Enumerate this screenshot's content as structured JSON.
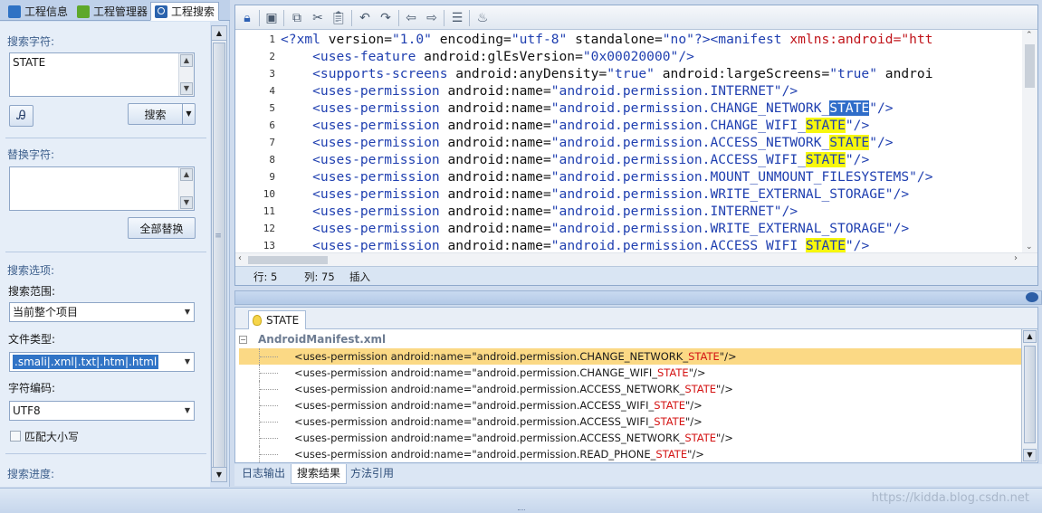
{
  "left_tabs": [
    {
      "label": "工程信息",
      "icon": "project-info-icon"
    },
    {
      "label": "工程管理器",
      "icon": "android-icon"
    },
    {
      "label": "工程搜索",
      "icon": "search-icon"
    }
  ],
  "search": {
    "group_title": "搜索字符:",
    "value": "STATE",
    "button_label": "搜索"
  },
  "replace": {
    "group_title": "替换字符:",
    "value": "",
    "button_label": "全部替换"
  },
  "options": {
    "group_title": "搜索选项:",
    "scope_label": "搜索范围:",
    "scope_value": "当前整个项目",
    "filetype_label": "文件类型:",
    "filetype_value": ".smali|.xml|.txt|.htm|.html",
    "encoding_label": "字符编码:",
    "encoding_value": "UTF8",
    "match_case_label": "匹配大小写",
    "match_case_checked": false
  },
  "progress": {
    "group_title": "搜索进度:"
  },
  "editor": {
    "toolbar_icons": [
      "lock-icon",
      "save-icon",
      "copy-icon",
      "cut-icon",
      "paste-icon",
      "undo-icon",
      "redo-icon",
      "back-icon",
      "forward-icon",
      "format-icon",
      "java-icon"
    ],
    "lines": [
      {
        "n": "1",
        "segments": [
          [
            "tag",
            "<?xml "
          ],
          [
            "attr",
            "version="
          ],
          [
            "str",
            "\"1.0\" "
          ],
          [
            "attr",
            "encoding="
          ],
          [
            "str",
            "\"utf-8\" "
          ],
          [
            "attr",
            "standalone="
          ],
          [
            "str",
            "\"no\""
          ],
          [
            "tag",
            "?><manifest "
          ],
          [
            "attr-red",
            "xmlns:android="
          ],
          [
            "attr-red",
            "\"htt"
          ]
        ]
      },
      {
        "n": "2",
        "segments": [
          [
            "tag",
            "    <uses-feature "
          ],
          [
            "attr",
            "android:glEsVersion="
          ],
          [
            "str",
            "\"0x00020000\""
          ],
          [
            "tag",
            "/>"
          ]
        ]
      },
      {
        "n": "3",
        "segments": [
          [
            "tag",
            "    <supports-screens "
          ],
          [
            "attr",
            "android:anyDensity="
          ],
          [
            "str",
            "\"true\" "
          ],
          [
            "attr",
            "android:largeScreens="
          ],
          [
            "str",
            "\"true\" "
          ],
          [
            "attr",
            "androi"
          ]
        ]
      },
      {
        "n": "4",
        "segments": [
          [
            "tag",
            "    <uses-permission "
          ],
          [
            "attr",
            "android:name="
          ],
          [
            "str",
            "\"android.permission.INTERNET\""
          ],
          [
            "tag",
            "/>"
          ]
        ]
      },
      {
        "n": "5",
        "segments": [
          [
            "tag",
            "    <uses-permission "
          ],
          [
            "attr",
            "android:name="
          ],
          [
            "str",
            "\"android.permission.CHANGE_NETWORK_"
          ],
          [
            "hl-sel",
            "STATE"
          ],
          [
            "str",
            "\""
          ],
          [
            "tag",
            "/>"
          ]
        ]
      },
      {
        "n": "6",
        "segments": [
          [
            "tag",
            "    <uses-permission "
          ],
          [
            "attr",
            "android:name="
          ],
          [
            "str",
            "\"android.permission.CHANGE_WIFI_"
          ],
          [
            "hl-yellow",
            "STATE"
          ],
          [
            "str",
            "\""
          ],
          [
            "tag",
            "/>"
          ]
        ]
      },
      {
        "n": "7",
        "segments": [
          [
            "tag",
            "    <uses-permission "
          ],
          [
            "attr",
            "android:name="
          ],
          [
            "str",
            "\"android.permission.ACCESS_NETWORK_"
          ],
          [
            "hl-yellow",
            "STATE"
          ],
          [
            "str",
            "\""
          ],
          [
            "tag",
            "/>"
          ]
        ]
      },
      {
        "n": "8",
        "segments": [
          [
            "tag",
            "    <uses-permission "
          ],
          [
            "attr",
            "android:name="
          ],
          [
            "str",
            "\"android.permission.ACCESS_WIFI_"
          ],
          [
            "hl-yellow",
            "STATE"
          ],
          [
            "str",
            "\""
          ],
          [
            "tag",
            "/>"
          ]
        ]
      },
      {
        "n": "9",
        "segments": [
          [
            "tag",
            "    <uses-permission "
          ],
          [
            "attr",
            "android:name="
          ],
          [
            "str",
            "\"android.permission.MOUNT_UNMOUNT_FILESYSTEMS\""
          ],
          [
            "tag",
            "/>"
          ]
        ]
      },
      {
        "n": "10",
        "segments": [
          [
            "tag",
            "    <uses-permission "
          ],
          [
            "attr",
            "android:name="
          ],
          [
            "str",
            "\"android.permission.WRITE_EXTERNAL_STORAGE\""
          ],
          [
            "tag",
            "/>"
          ]
        ]
      },
      {
        "n": "11",
        "segments": [
          [
            "tag",
            "    <uses-permission "
          ],
          [
            "attr",
            "android:name="
          ],
          [
            "str",
            "\"android.permission.INTERNET\""
          ],
          [
            "tag",
            "/>"
          ]
        ]
      },
      {
        "n": "12",
        "segments": [
          [
            "tag",
            "    <uses-permission "
          ],
          [
            "attr",
            "android:name="
          ],
          [
            "str",
            "\"android.permission.WRITE_EXTERNAL_STORAGE\""
          ],
          [
            "tag",
            "/>"
          ]
        ]
      },
      {
        "n": "13",
        "segments": [
          [
            "tag",
            "    <uses-permission "
          ],
          [
            "attr",
            "android:name="
          ],
          [
            "str",
            "\"android.permission.ACCESS_WIFI_"
          ],
          [
            "hl-yellow",
            "STATE"
          ],
          [
            "str",
            "\""
          ],
          [
            "tag",
            "/>"
          ]
        ]
      }
    ],
    "status": {
      "row_label": "行: 5",
      "col_label": "列: 75",
      "mode_label": "插入"
    }
  },
  "results": {
    "tab_label": "STATE",
    "file_name": "AndroidManifest.xml",
    "rows": [
      {
        "prefix": "<uses-permission android:name=\"android.permission.CHANGE_NETWORK_",
        "match": "STATE",
        "suffix": "\"/>",
        "selected": true
      },
      {
        "prefix": "<uses-permission android:name=\"android.permission.CHANGE_WIFI_",
        "match": "STATE",
        "suffix": "\"/>",
        "selected": false
      },
      {
        "prefix": "<uses-permission android:name=\"android.permission.ACCESS_NETWORK_",
        "match": "STATE",
        "suffix": "\"/>",
        "selected": false
      },
      {
        "prefix": "<uses-permission android:name=\"android.permission.ACCESS_WIFI_",
        "match": "STATE",
        "suffix": "\"/>",
        "selected": false
      },
      {
        "prefix": "<uses-permission android:name=\"android.permission.ACCESS_WIFI_",
        "match": "STATE",
        "suffix": "\"/>",
        "selected": false
      },
      {
        "prefix": "<uses-permission android:name=\"android.permission.ACCESS_NETWORK_",
        "match": "STATE",
        "suffix": "\"/>",
        "selected": false
      },
      {
        "prefix": "<uses-permission android:name=\"android.permission.READ_PHONE_",
        "match": "STATE",
        "suffix": "\"/>",
        "selected": false
      }
    ]
  },
  "bottom_tabs": [
    "日志输出",
    "搜索结果",
    "方法引用"
  ],
  "bottom_tab_active": 1,
  "watermark": "https://kidda.blog.csdn.net",
  "colors": {
    "highlight": "#f7f70d",
    "selection": "#2f6dc9",
    "selected_row": "#fbd985",
    "match_text": "#d41414"
  }
}
